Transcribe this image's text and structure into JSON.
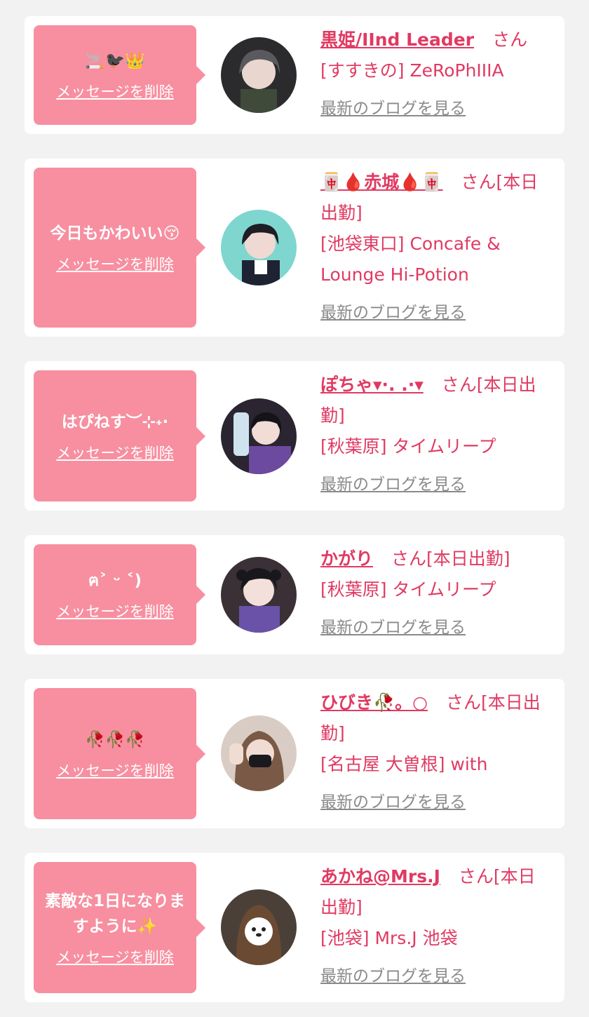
{
  "colors": {
    "page_bg": "#f2f2f2",
    "card_bg": "#ffffff",
    "bubble_bg": "#f78fa0",
    "accent": "#e03a62",
    "link_gray": "#8a8a8a"
  },
  "entries": [
    {
      "message": "🚬🐦‍⬛👑",
      "delete_label": "メッセージを削除",
      "name": "黒姫/IInd Leader",
      "san": "さん",
      "shop": "[すすきの] ZeRoPhIIIA",
      "blog_label": "最新のブログを見る"
    },
    {
      "message": "今日もかわいい😚",
      "delete_label": "メッセージを削除",
      "name": "🀄🩸赤城🩸🀄",
      "san": "さん[本日出勤]",
      "shop": "[池袋東口] Concafe & Lounge Hi-Potion",
      "blog_label": "最新のブログを見る"
    },
    {
      "message": "はぴねす︶⊹˖·",
      "delete_label": "メッセージを削除",
      "name": "ぽちゃ▾·. .·▾",
      "san": "さん[本日出勤]",
      "shop": "[秋葉原] タイムリープ",
      "blog_label": "最新のブログを見る"
    },
    {
      "message": "ฅ˃ ᵕ ˂)",
      "delete_label": "メッセージを削除",
      "name": "かがり",
      "san": "さん[本日出勤]",
      "shop": "[秋葉原] タイムリープ",
      "blog_label": "最新のブログを見る"
    },
    {
      "message": "🥀🥀🥀",
      "delete_label": "メッセージを削除",
      "name": "ひびき🥀。○",
      "san": "さん[本日出勤]",
      "shop": "[名古屋 大曽根] with",
      "blog_label": "最新のブログを見る"
    },
    {
      "message": "素敵な1日になりますように✨",
      "delete_label": "メッセージを削除",
      "name": "あかね@Mrs.J",
      "san": "さん[本日出勤]",
      "shop": "[池袋] Mrs.J 池袋",
      "blog_label": "最新のブログを見る"
    }
  ]
}
